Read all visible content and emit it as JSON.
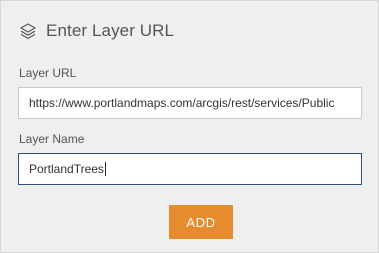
{
  "header": {
    "title": "Enter Layer URL",
    "icon": "layers-icon"
  },
  "form": {
    "layer_url": {
      "label": "Layer URL",
      "value": "https://www.portlandmaps.com/arcgis/rest/services/Public"
    },
    "layer_name": {
      "label": "Layer Name",
      "value": "PortlandTrees"
    }
  },
  "actions": {
    "add_label": "ADD"
  },
  "colors": {
    "panel_background": "#efefef",
    "accent_button": "#e68c2f",
    "focused_border": "#2f4f7a"
  }
}
